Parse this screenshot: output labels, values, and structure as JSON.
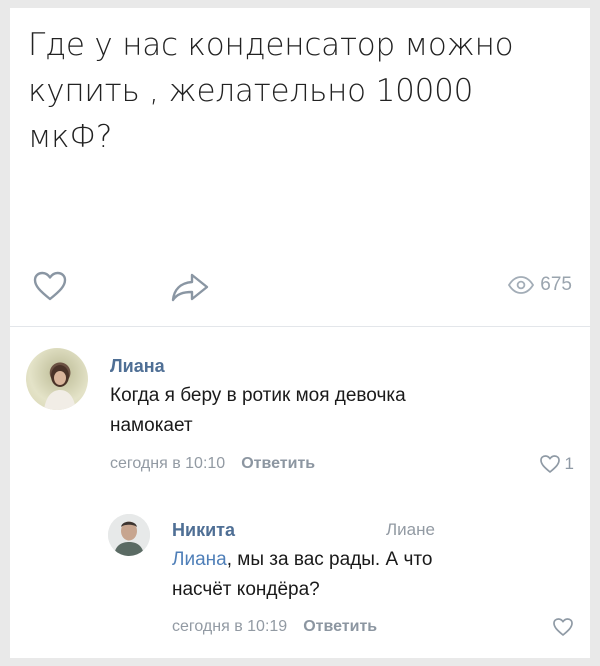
{
  "post": {
    "text_lines": [
      "Где у нас конденсатор можно",
      "купить , желательно 10000",
      "мкФ?"
    ],
    "views": "675"
  },
  "comments": [
    {
      "author": "Лиана",
      "text_lines": [
        "Когда я беру в ротик моя девочка",
        "намокает"
      ],
      "time": "сегодня в 10:10",
      "reply_label": "Ответить",
      "likes": "1"
    },
    {
      "author": "Никита",
      "reply_to": "Лиане",
      "mention": "Лиана",
      "text_rest": ", мы за вас рады. А что",
      "text_line2": "насчёт кондёра?",
      "time": "сегодня в 10:19",
      "reply_label": "Ответить"
    }
  ],
  "colors": {
    "link": "#4f6f95",
    "muted": "#929aa3"
  },
  "icons": [
    "heart-icon",
    "share-icon",
    "eye-icon"
  ]
}
